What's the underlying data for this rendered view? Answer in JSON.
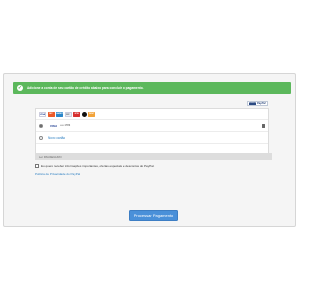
{
  "alert": {
    "icon": "check-circle-icon",
    "message": "Adicione a conta de seu cartão de crédito abaixo para concluir o pagamento."
  },
  "brand": {
    "badge": "Braintree",
    "name": "PayPal"
  },
  "card_logos": [
    "VISA",
    "MC",
    "AMEX",
    "DC",
    "JCB",
    "",
    "DISC"
  ],
  "saved_card": {
    "brand": "VISA",
    "masked": "•••• 1783",
    "selected": true
  },
  "new_card": {
    "label": "Novo cartão"
  },
  "section": {
    "label": "Ler PAGSEGURO"
  },
  "opt_in": {
    "label": "Eu quero receber informações importantes, ofertas especiais e descontos do PayPal."
  },
  "privacy_link": "Política de Privacidade do PayPal",
  "pay_button": "Processar Pagamento",
  "colors": {
    "alert": "#5cb85c",
    "button": "#4a90d9",
    "link": "#2a7dc0"
  }
}
